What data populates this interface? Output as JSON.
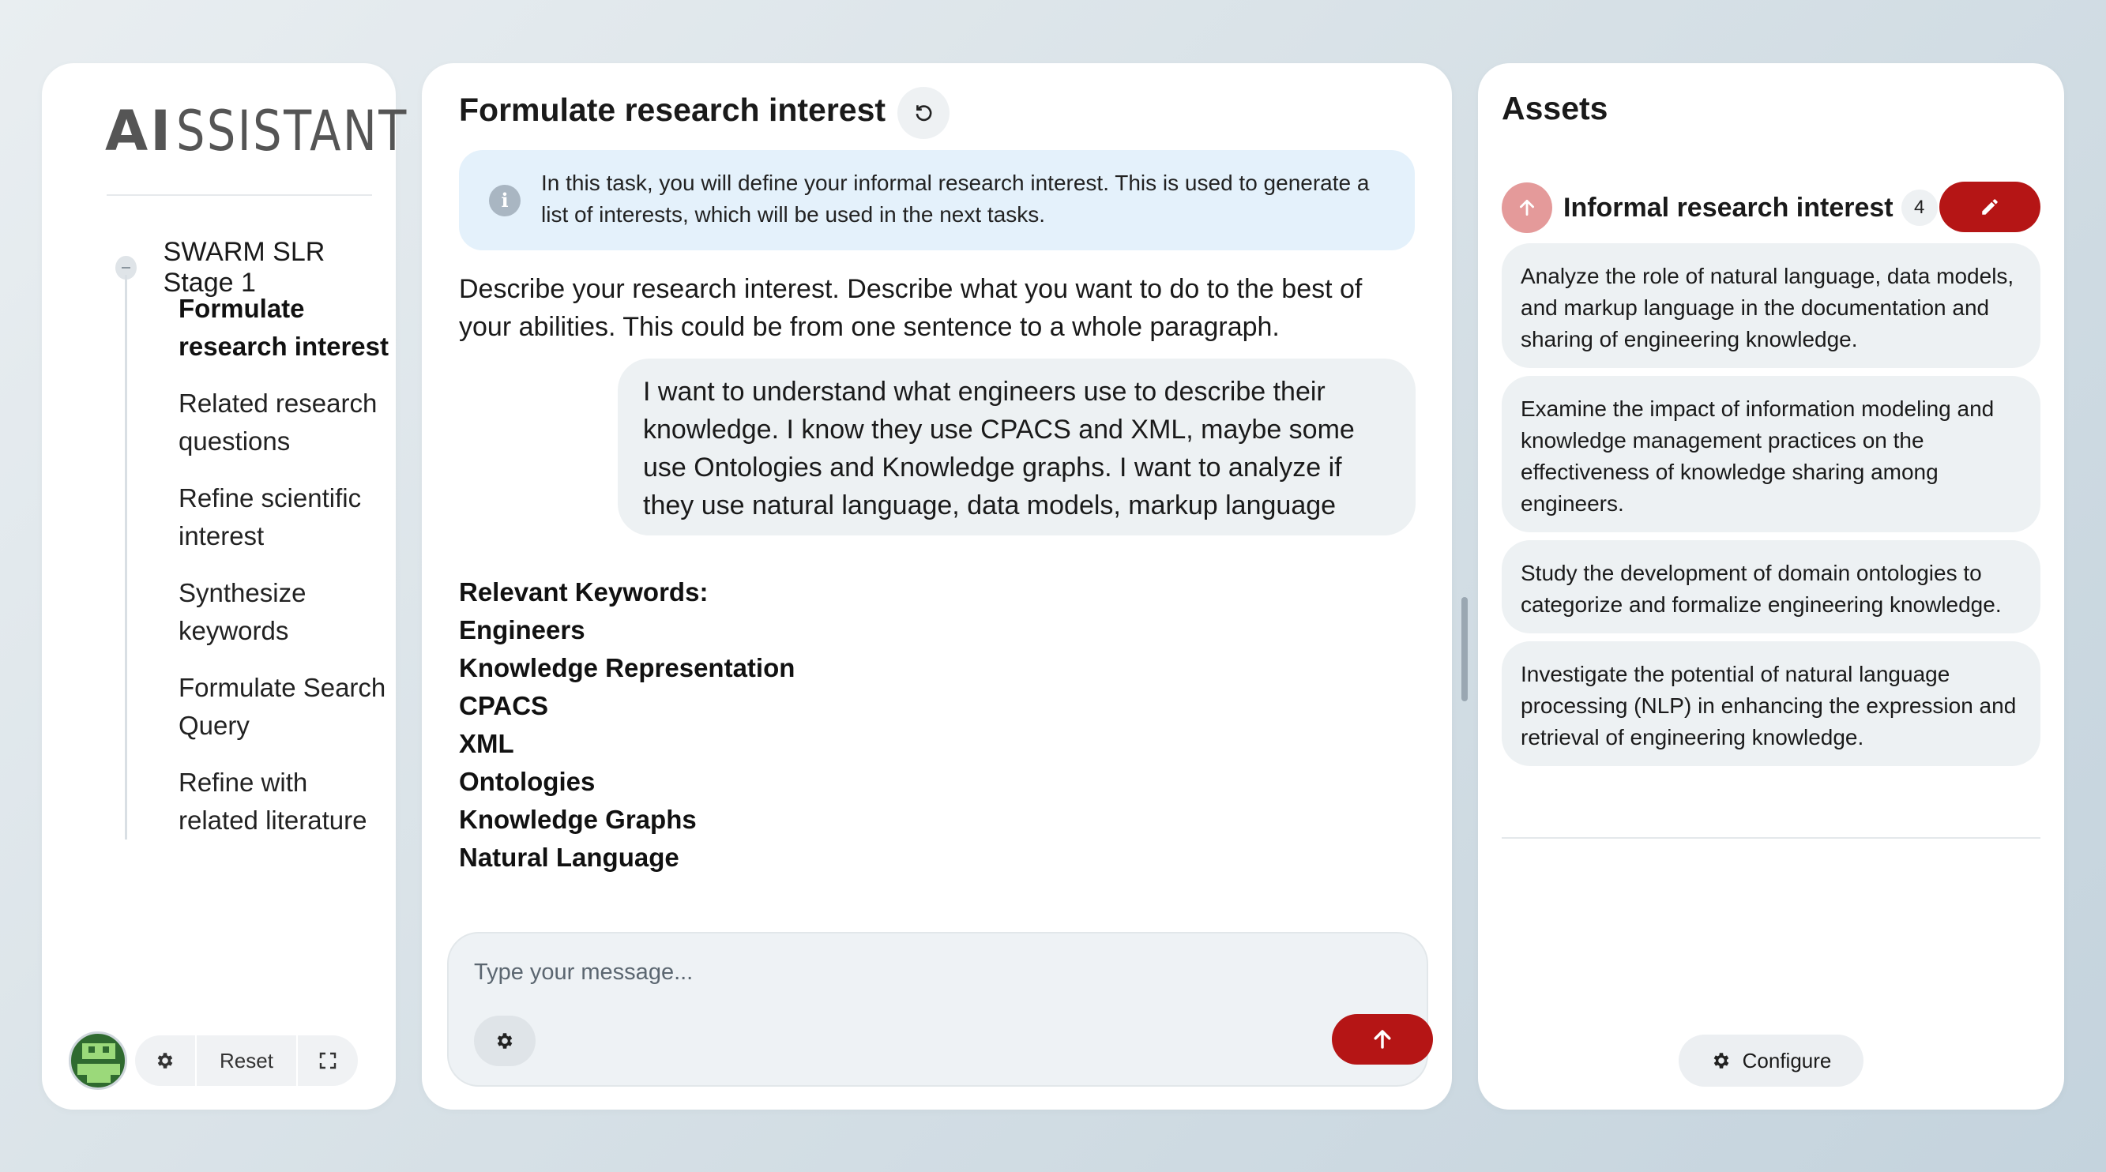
{
  "app": {
    "logo_bold": "AI",
    "logo_rest": "SSISTANT"
  },
  "sidebar": {
    "stage_label": "SWARM SLR Stage 1",
    "steps": [
      {
        "label": "Formulate research interest",
        "active": true
      },
      {
        "label": "Related research questions",
        "active": false
      },
      {
        "label": "Refine scientific interest",
        "active": false
      },
      {
        "label": "Synthesize keywords",
        "active": false
      },
      {
        "label": "Formulate Search Query",
        "active": false
      },
      {
        "label": "Refine with related literature",
        "active": false
      }
    ],
    "footer": {
      "reset_label": "Reset",
      "icons": [
        "avatar",
        "gear-icon",
        "expand-icon"
      ]
    }
  },
  "main": {
    "title": "Formulate research interest",
    "info_text": "In this task, you will define your informal research interest. This is used to generate a list of interests, which will be used in the next tasks.",
    "prompt": "Describe your research interest. Describe what you want to do to the best of your abilities. This could be from one sentence to a whole paragraph.",
    "user_message": "I want to understand what engineers use to describe their knowledge. I know they use CPACS and XML, maybe some use Ontologies and Knowledge graphs. I want to analyze if they use natural language, data models, markup language",
    "keywords_heading": "Relevant Keywords:",
    "keywords": [
      "Engineers",
      "Knowledge Representation",
      "CPACS",
      "XML",
      "Ontologies",
      "Knowledge Graphs",
      "Natural Language"
    ],
    "composer": {
      "placeholder": "Type your message..."
    }
  },
  "assets": {
    "title": "Assets",
    "group_name": "Informal research interest",
    "count": "4",
    "items": [
      "Analyze the role of natural language, data models, and markup language in the documentation and sharing of engineering knowledge.",
      "Examine the impact of information modeling and knowledge management practices on the effectiveness of knowledge sharing among engineers.",
      "Study the development of domain ontologies to categorize and formalize engineering knowledge.",
      "Investigate the potential of natural language processing (NLP) in enhancing the expression and retrieval of engineering knowledge."
    ],
    "configure_label": "Configure"
  },
  "colors": {
    "accent": "#b51515",
    "accent_soft": "#e49a9a",
    "info_bg": "#e4f1fb",
    "bubble_bg": "#edf1f3"
  }
}
